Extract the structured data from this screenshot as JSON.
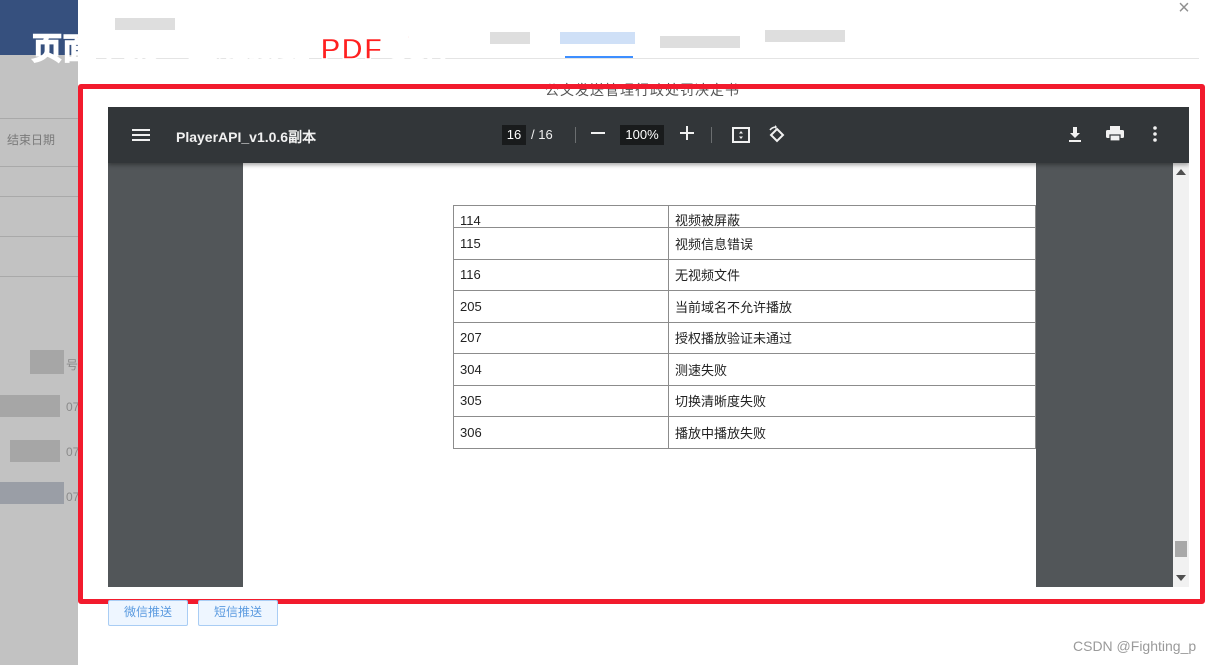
{
  "annotation": {
    "title": "页面中某一区域预览 PDF 文件",
    "box_color": "#f21b2d"
  },
  "background_page": {
    "end_date_label": "结束日期",
    "col_fragment": "号",
    "row_fragments": [
      "07",
      "07",
      "07"
    ]
  },
  "modal": {
    "document_heading": "公文发送管理行政处罚决定书",
    "close_symbol": "×"
  },
  "pdf_viewer": {
    "file_name": "PlayerAPI_v1.0.6副本",
    "current_page": "16",
    "total_pages": "/ 16",
    "zoom": "100%",
    "icons": [
      "menu-icon",
      "zoom-out-icon",
      "zoom-in-icon",
      "fit-page-icon",
      "rotate-icon",
      "download-icon",
      "print-icon",
      "more-icon"
    ],
    "table_rows": [
      {
        "code": "114",
        "desc": "视频被屏蔽"
      },
      {
        "code": "115",
        "desc": "视频信息错误"
      },
      {
        "code": "116",
        "desc": "无视频文件"
      },
      {
        "code": "205",
        "desc": "当前域名不允许播放"
      },
      {
        "code": "207",
        "desc": "授权播放验证未通过"
      },
      {
        "code": "304",
        "desc": "测速失败"
      },
      {
        "code": "305",
        "desc": "切换清晰度失败"
      },
      {
        "code": "306",
        "desc": "播放中播放失败"
      }
    ]
  },
  "buttons": {
    "wechat_push": "微信推送",
    "sms_push": "短信推送"
  },
  "watermark": "CSDN @Fighting_p",
  "colors": {
    "accent": "#3d8eff",
    "toolbar": "#323639",
    "viewer_bg": "#525659"
  }
}
